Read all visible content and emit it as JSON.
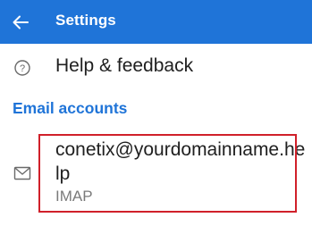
{
  "header": {
    "title": "Settings",
    "back_icon": "arrow-left-icon",
    "background_color": "#1f74d8"
  },
  "help_row": {
    "icon": "help-circle-icon",
    "label": "Help & feedback"
  },
  "email_section": {
    "header": "Email accounts",
    "accent_color": "#1f74d8"
  },
  "account": {
    "icon": "mail-icon",
    "address": "conetix@yourdomainname.help",
    "type": "IMAP"
  },
  "annotation": {
    "highlight_color": "#d0202a"
  }
}
